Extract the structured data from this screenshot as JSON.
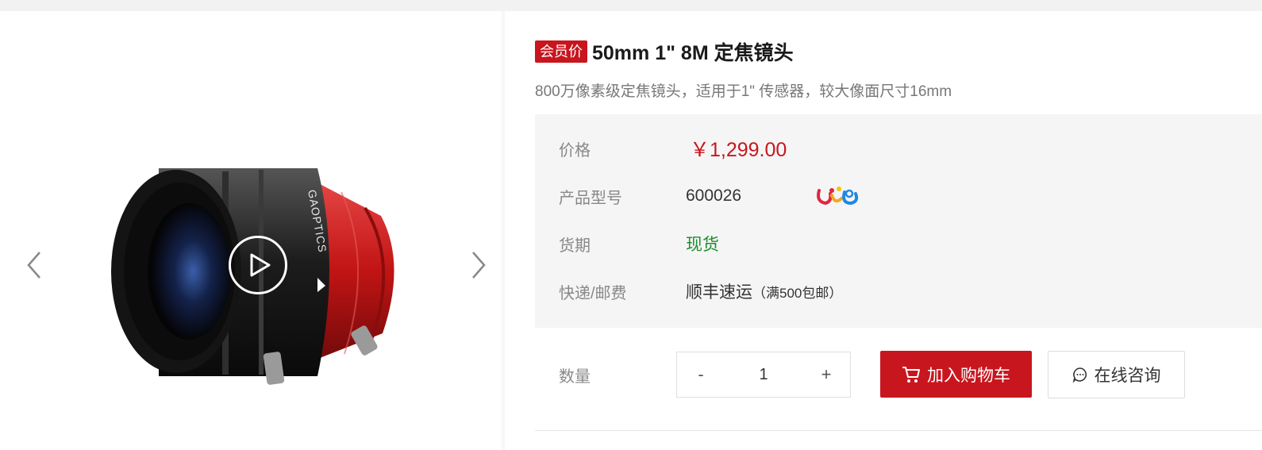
{
  "gallery": {
    "prev_icon": "chevron-left-icon",
    "next_icon": "chevron-right-icon",
    "play_icon": "play-icon",
    "image_icon": "camera-lens-image",
    "lens_brand_text": "GAOPTICS"
  },
  "product": {
    "member_badge": "会员价",
    "title": "50mm 1\" 8M 定焦镜头",
    "subtitle": "800万像素级定焦镜头，适用于1\" 传感器，较大像面尺寸16mm"
  },
  "specs": {
    "price_label": "价格",
    "price_value": "￥1,299.00",
    "model_label": "产品型号",
    "model_value": "600026",
    "delivery_label": "货期",
    "delivery_value": "现货",
    "shipping_label": "快递/邮费",
    "shipping_value": "顺丰速运",
    "shipping_note": "（满500包邮）"
  },
  "purchase": {
    "qty_label": "数量",
    "qty_minus": "-",
    "qty_value": "1",
    "qty_plus": "+",
    "cart_label": "加入购物车",
    "consult_label": "在线咨询"
  },
  "colors": {
    "accent": "#c8161e",
    "stock_green": "#1a8f2a",
    "spec_bg": "#f5f5f5"
  }
}
